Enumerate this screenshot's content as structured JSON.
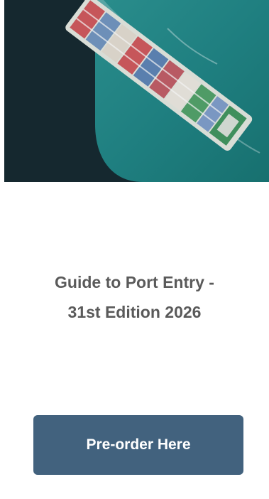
{
  "hero": {
    "image_icon": "container-ship-aerial-image",
    "colors": {
      "panel": "#15282f",
      "sea": "#1f7f80"
    }
  },
  "title": {
    "line1": "Guide to Port Entry -",
    "line2": "31st Edition 2026",
    "color": "#5a5a5a"
  },
  "cta": {
    "label": "Pre-order Here",
    "background": "#42627e",
    "text_color": "#ffffff"
  }
}
